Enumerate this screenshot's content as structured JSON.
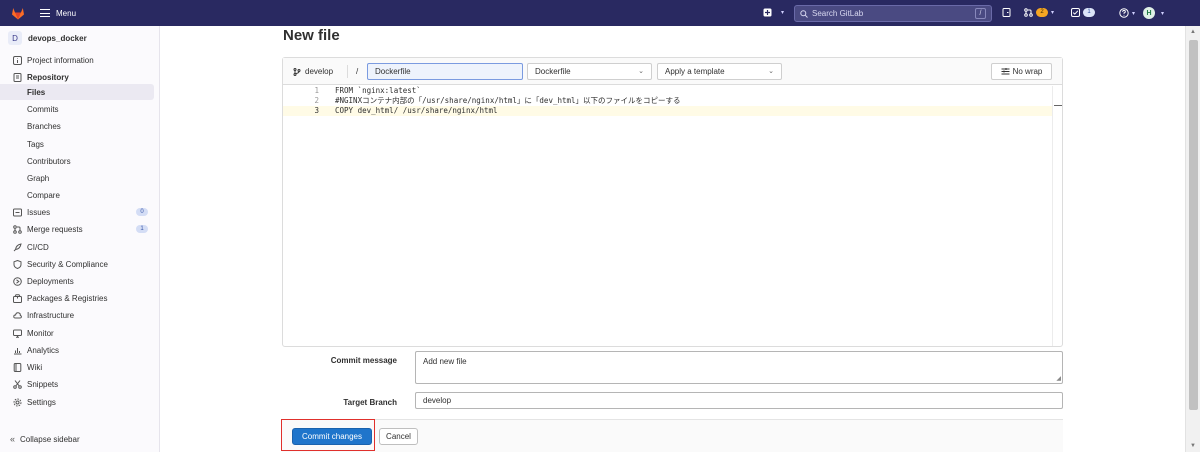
{
  "topbar": {
    "menu_label": "Menu",
    "search_placeholder": "Search GitLab",
    "search_shortcut": "/",
    "merge_requests_count": "2",
    "todos_count": "1",
    "avatar_initial": "H"
  },
  "sidebar": {
    "project_initial": "D",
    "project_name": "devops_docker",
    "items": [
      {
        "label": "Project information",
        "icon": "info-icon"
      },
      {
        "label": "Repository",
        "icon": "repository-icon"
      },
      {
        "label": "Files",
        "icon": ""
      },
      {
        "label": "Commits",
        "icon": ""
      },
      {
        "label": "Branches",
        "icon": ""
      },
      {
        "label": "Tags",
        "icon": ""
      },
      {
        "label": "Contributors",
        "icon": ""
      },
      {
        "label": "Graph",
        "icon": ""
      },
      {
        "label": "Compare",
        "icon": ""
      },
      {
        "label": "Issues",
        "icon": "issues-icon",
        "count": "0"
      },
      {
        "label": "Merge requests",
        "icon": "merge-request-icon",
        "count": "1"
      },
      {
        "label": "CI/CD",
        "icon": "rocket-icon"
      },
      {
        "label": "Security & Compliance",
        "icon": "shield-icon"
      },
      {
        "label": "Deployments",
        "icon": "deployments-icon"
      },
      {
        "label": "Packages & Registries",
        "icon": "package-icon"
      },
      {
        "label": "Infrastructure",
        "icon": "cloud-icon"
      },
      {
        "label": "Monitor",
        "icon": "monitor-icon"
      },
      {
        "label": "Analytics",
        "icon": "chart-icon"
      },
      {
        "label": "Wiki",
        "icon": "book-icon"
      },
      {
        "label": "Snippets",
        "icon": "snippet-icon"
      },
      {
        "label": "Settings",
        "icon": "gear-icon"
      }
    ],
    "collapse_label": "Collapse sidebar"
  },
  "main": {
    "title": "New file",
    "editor": {
      "branch": "develop",
      "path_separator": "/",
      "file_name": "Dockerfile",
      "file_type": "Dockerfile",
      "template_placeholder": "Apply a template",
      "wrap_label": "No wrap",
      "lines": [
        {
          "n": "1",
          "text": "FROM `nginx:latest`"
        },
        {
          "n": "2",
          "text": "#NGINXコンテナ内部の「/usr/share/nginx/html」に「dev_html」以下のファイルをコピーする"
        },
        {
          "n": "3",
          "text": "COPY dev_html/ /usr/share/nginx/html"
        }
      ]
    },
    "commit_form": {
      "message_label": "Commit message",
      "message_value": "Add new file",
      "branch_label": "Target Branch",
      "branch_value": "develop"
    },
    "actions": {
      "commit_label": "Commit changes",
      "cancel_label": "Cancel"
    }
  },
  "colors": {
    "topbar": "#292961",
    "primary": "#1f75cb",
    "highlight_box": "#e0302c"
  }
}
